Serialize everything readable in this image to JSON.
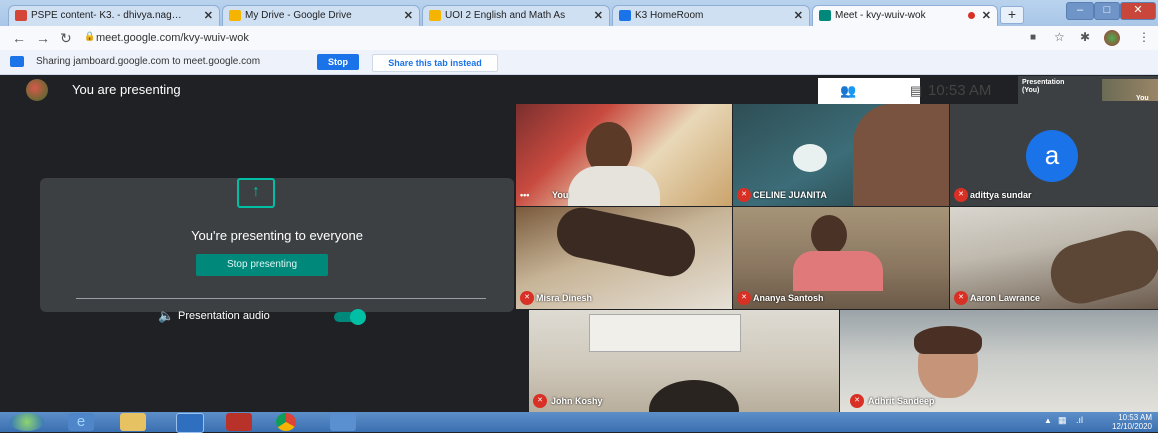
{
  "browser": {
    "tabs": [
      {
        "label": "PSPE content- K3. - dhivya.nag…",
        "icon_color": "#d44638"
      },
      {
        "label": "My Drive - Google Drive",
        "icon_color": "#f4b400"
      },
      {
        "label": "UOI 2 English and Math As",
        "icon_color": "#f4b400"
      },
      {
        "label": "K3 HomeRoom",
        "icon_color": "#1a73e8"
      },
      {
        "label": "Meet - kvy-wuiv-wok",
        "icon_color": "#00897b"
      }
    ],
    "new_tab": "+",
    "url": "meet.google.com/kvy-wuiv-wok",
    "window_buttons": {
      "minimize": "–",
      "maximize": "□",
      "close": "✕"
    }
  },
  "share_bar": {
    "text": "Sharing jamboard.google.com to meet.google.com",
    "stop_label": "Stop",
    "share_instead_label": "Share this tab instead"
  },
  "meet": {
    "presenting_label": "You are presenting",
    "panel_title": "You're presenting to everyone",
    "stop_presenting_label": "Stop presenting",
    "audio_label": "Presentation audio",
    "clock": "10:53 AM",
    "self_tile_label": "Presentation\n(You)",
    "self_you_label": "You",
    "accent": "#00897b",
    "participants": [
      {
        "name": "You",
        "muted": false
      },
      {
        "name": "CELINE JUANITA",
        "muted": true
      },
      {
        "name": "adittya sundar",
        "muted": true,
        "initial": "a"
      },
      {
        "name": "Misra Dinesh",
        "muted": true
      },
      {
        "name": "Ananya Santosh",
        "muted": true
      },
      {
        "name": "Aaron Lawrance",
        "muted": true
      },
      {
        "name": "John Koshy",
        "muted": true
      },
      {
        "name": "Adhrit Sandeep",
        "muted": true
      }
    ]
  },
  "taskbar": {
    "time": "10:53 AM",
    "date": "12/10/2020"
  }
}
